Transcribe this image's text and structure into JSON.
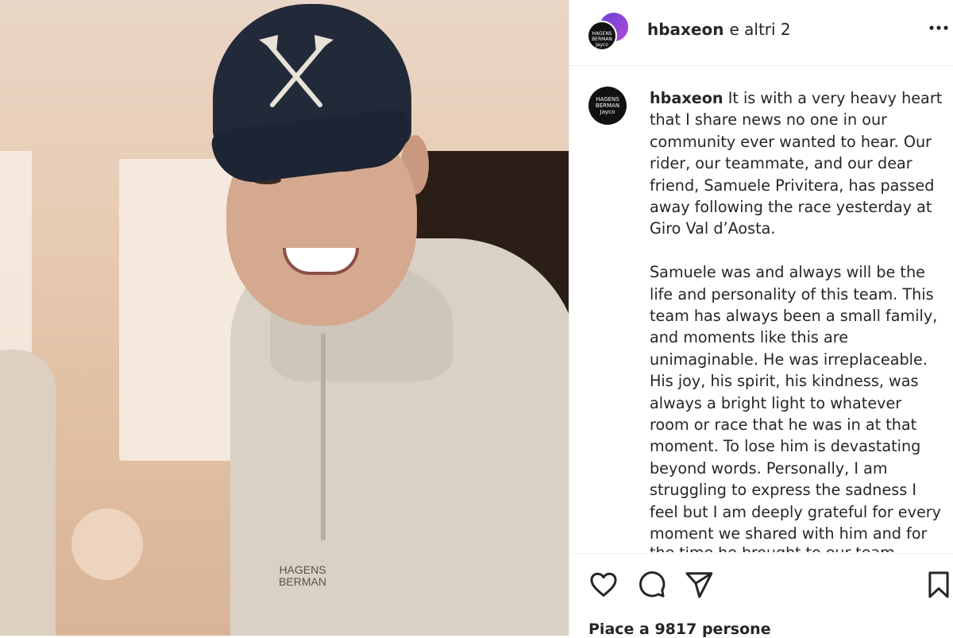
{
  "header": {
    "username": "hbaxeon",
    "others": "e altri 2",
    "more_icon": "more-horizontal-icon",
    "avatar_text": "HAGENS BERMAN Jayco"
  },
  "caption": {
    "username": "hbaxeon",
    "paragraph1": "It is with a very heavy heart that I share news no one in our community ever wanted to hear. Our rider, our teammate, and our dear friend, Samuele Privitera, has passed away following the race yesterday at Giro Val d’Aosta.",
    "paragraph2": "Samuele was and always will be the life and personality of this team. This team has always been a small family, and moments like this are unimaginable. He was irreplaceable. His joy, his spirit, his kindness, was always a bright light to whatever room or race that he was in at that moment. To lose him is devastating beyond words. Personally, I am struggling to express the sadness I feel but I am deeply grateful for every moment we shared with him and for",
    "cut_line": "the time he brought to our team"
  },
  "photo": {
    "shirt_logo_line1": "HAGENS",
    "shirt_logo_line2": "BERMAN"
  },
  "actions": {
    "like_icon": "heart-icon",
    "comment_icon": "comment-icon",
    "share_icon": "send-icon",
    "save_icon": "bookmark-icon",
    "likes_text": "Piace a 9817 persone"
  }
}
